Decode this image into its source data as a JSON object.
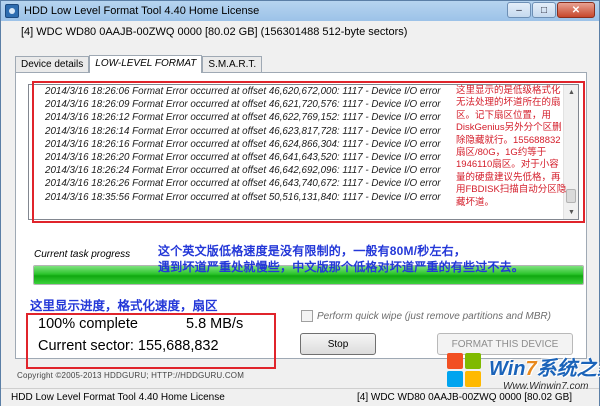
{
  "window": {
    "title": "HDD Low Level Format Tool 4.40    Home License",
    "controls": {
      "minimize": "–",
      "maximize": "□",
      "close": "✕"
    }
  },
  "drive_line": "[4]  WDC WD80 0AAJB-00ZWQ    0000    [80.02 GB]    (156301488 512-byte sectors)",
  "tabs": [
    {
      "label": "Device details"
    },
    {
      "label": "LOW-LEVEL FORMAT"
    },
    {
      "label": "S.M.A.R.T."
    }
  ],
  "log": {
    "lines": [
      "2014/3/16 18:26:06   Format Error occurred at offset 46,620,672,000:   1117 - Device I/O error",
      "2014/3/16 18:26:09   Format Error occurred at offset 46,621,720,576:   1117 - Device I/O error",
      "2014/3/16 18:26:12   Format Error occurred at offset 46,622,769,152:   1117 - Device I/O error",
      "2014/3/16 18:26:14   Format Error occurred at offset 46,623,817,728:   1117 - Device I/O error",
      "2014/3/16 18:26:16   Format Error occurred at offset 46,624,866,304:   1117 - Device I/O error",
      "2014/3/16 18:26:20   Format Error occurred at offset 46,641,643,520:   1117 - Device I/O error",
      "2014/3/16 18:26:24   Format Error occurred at offset 46,642,692,096:   1117 - Device I/O error",
      "2014/3/16 18:26:26   Format Error occurred at offset 46,643,740,672:   1117 - Device I/O error",
      "2014/3/16 18:35:56   Format Error occurred at offset 50,516,131,840:   1117 - Device I/O error"
    ]
  },
  "annotations": {
    "log_note": "这里显示的是低级格式化无法处理的坏道所在的扇区。记下扇区位置，用DiskGenius另外分个区删除隐藏就行。155688832扇区/80G，1G约等于1946110扇区。对于小容量的硬盘建议先低格，再用FBDISK扫描自动分区隐藏坏道。",
    "speed_note_line1": "这个英文版低格速度是没有限制的，一般有80M/秒左右，",
    "speed_note_line2": "遇到坏道严重处就慢些，中文版那个低格对坏道严重的有些过不去。",
    "progress_note": "这里显示进度，格式化速度，扇区"
  },
  "progress": {
    "label": "Current task progress",
    "fraction": 1.0
  },
  "stats": {
    "percent_text": "100% complete",
    "speed_text": "5.8 MB/s",
    "sector_text": "Current sector: 155,688,832"
  },
  "options": {
    "quick_wipe_label": "Perform quick wipe (just remove partitions and MBR)",
    "quick_wipe_checked": false
  },
  "buttons": {
    "stop": "Stop",
    "format": "FORMAT THIS DEVICE"
  },
  "copyright": "Copyright ©2005-2013 HDDGURU;   HTTP://HDDGURU.COM",
  "statusbar": {
    "left": "HDD Low Level Format Tool 4.40    Home License",
    "right": "[4]  WDC WD80 0AAJB-00ZWQ    0000    [80.02 GB]"
  },
  "watermark": {
    "title_pre": "Win",
    "title_num": "7",
    "title_post": "系统之家",
    "url": "Www.Winwin7.com"
  },
  "colors": {
    "annotation_red": "#e0242b",
    "annotation_blue": "#2438d8",
    "progress_green": "#10a810"
  }
}
